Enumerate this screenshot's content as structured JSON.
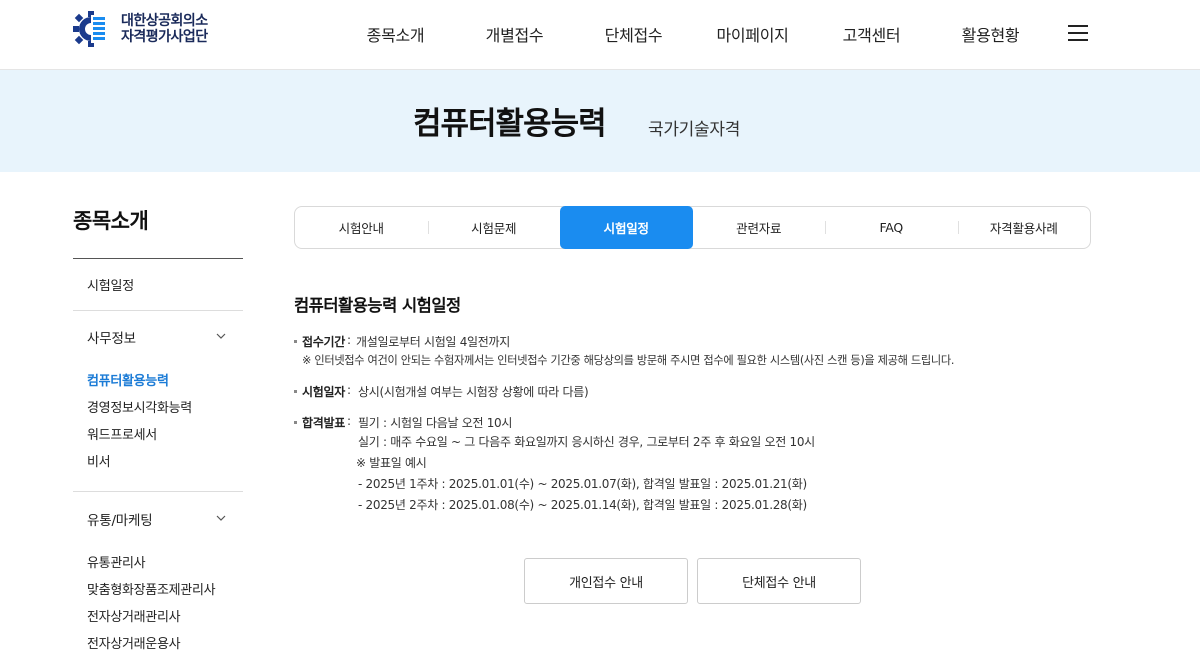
{
  "header": {
    "logo_line1": "대한상공회의소",
    "logo_line2": "자격평가사업단",
    "nav": [
      "종목소개",
      "개별접수",
      "단체접수",
      "마이페이지",
      "고객센터",
      "활용현황"
    ]
  },
  "banner": {
    "title": "컴퓨터활용능력",
    "subtitle": "국가기술자격"
  },
  "sidebar": {
    "title": "종목소개",
    "top_item": "시험일정",
    "groups": [
      {
        "label": "사무정보",
        "items": [
          "컴퓨터활용능력",
          "경영정보시각화능력",
          "워드프로세서",
          "비서"
        ]
      },
      {
        "label": "유통/마케팅",
        "items": [
          "유통관리사",
          "맞춤형화장품조제관리사",
          "전자상거래관리사",
          "전자상거래운용사"
        ]
      }
    ]
  },
  "tabs": [
    "시험안내",
    "시험문제",
    "시험일정",
    "관련자료",
    "FAQ",
    "자격활용사례"
  ],
  "active_tab_index": 2,
  "content": {
    "title": "컴퓨터활용능력 시험일정",
    "reception": {
      "label": "접수기간",
      "sep": ":",
      "value": "개설일로부터 시험일 4일전까지",
      "note": "※ 인터넷접수 여건이 안되는 수험자께서는 인터넷접수 기간중 해당상의를 방문해 주시면 접수에 필요한 시스템(사진 스캔 등)을 제공해 드립니다."
    },
    "exam_date": {
      "label": "시험일자",
      "sep": ":",
      "value": "상시(시험개설 여부는 시험장 상황에 따라 다름)"
    },
    "result": {
      "label": "합격발표",
      "sep": ":",
      "lines": [
        "필기 : 시험일 다음날 오전 10시",
        "실기 : 매주 수요일 ~ 그 다음주 화요일까지 응시하신 경우, 그로부터 2주 후 화요일 오전 10시",
        "※ 발표일 예시",
        "- 2025년 1주차 : 2025.01.01(수) ~ 2025.01.07(화), 합격일 발표일 : 2025.01.21(화)",
        "- 2025년 2주차 : 2025.01.08(수) ~ 2025.01.14(화), 합격일 발표일 : 2025.01.28(화)"
      ]
    }
  },
  "buttons": {
    "individual": "개인접수 안내",
    "group": "단체접수 안내"
  },
  "colors": {
    "accent": "#1a8cf0",
    "active_link": "#1b7bd6",
    "banner_bg": "#e8f4fc"
  }
}
